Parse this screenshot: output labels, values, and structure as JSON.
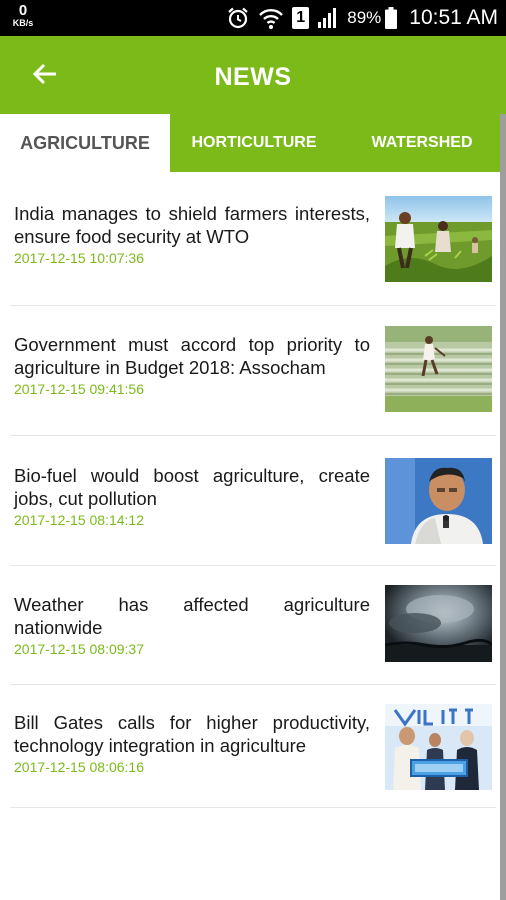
{
  "status_bar": {
    "net_speed": "0",
    "net_unit": "KB/s",
    "sim_label": "1",
    "battery": "89%",
    "time": "10:51 AM",
    "icons": [
      "alarm-icon",
      "wifi-icon",
      "signal-icon",
      "battery-icon"
    ]
  },
  "app_bar": {
    "title": "NEWS",
    "back_icon": "arrow-back-icon",
    "color": "#7cba1a"
  },
  "tabs": [
    {
      "label": "AGRICULTURE",
      "active": true
    },
    {
      "label": "HORTICULTURE",
      "active": false
    },
    {
      "label": "WATERSHED",
      "active": false
    }
  ],
  "news": [
    {
      "title": "India manages to shield farmers interests, ensure food security at WTO",
      "date": "2017-12-15 10:07:36",
      "image": "farmers-planting-photo"
    },
    {
      "title": "Government must accord top priority to agriculture in Budget 2018: Assocham",
      "date": "2017-12-15 09:41:56",
      "image": "farmer-in-field-photo"
    },
    {
      "title": "Bio-fuel would boost agriculture, create jobs, cut pollution",
      "date": "2017-12-15 08:14:12",
      "image": "minister-speaking-photo"
    },
    {
      "title": "Weather has affected agriculture nationwide",
      "date": "2017-12-15 08:09:37",
      "image": "storm-clouds-photo"
    },
    {
      "title": "Bill Gates calls for higher productivity, technology integration in agriculture",
      "date": "2017-12-15 08:06:16",
      "image": "event-stage-photo"
    }
  ],
  "colors": {
    "accent": "#7cba1a",
    "date_text": "#7cba1a",
    "active_tab_text": "#555555"
  }
}
